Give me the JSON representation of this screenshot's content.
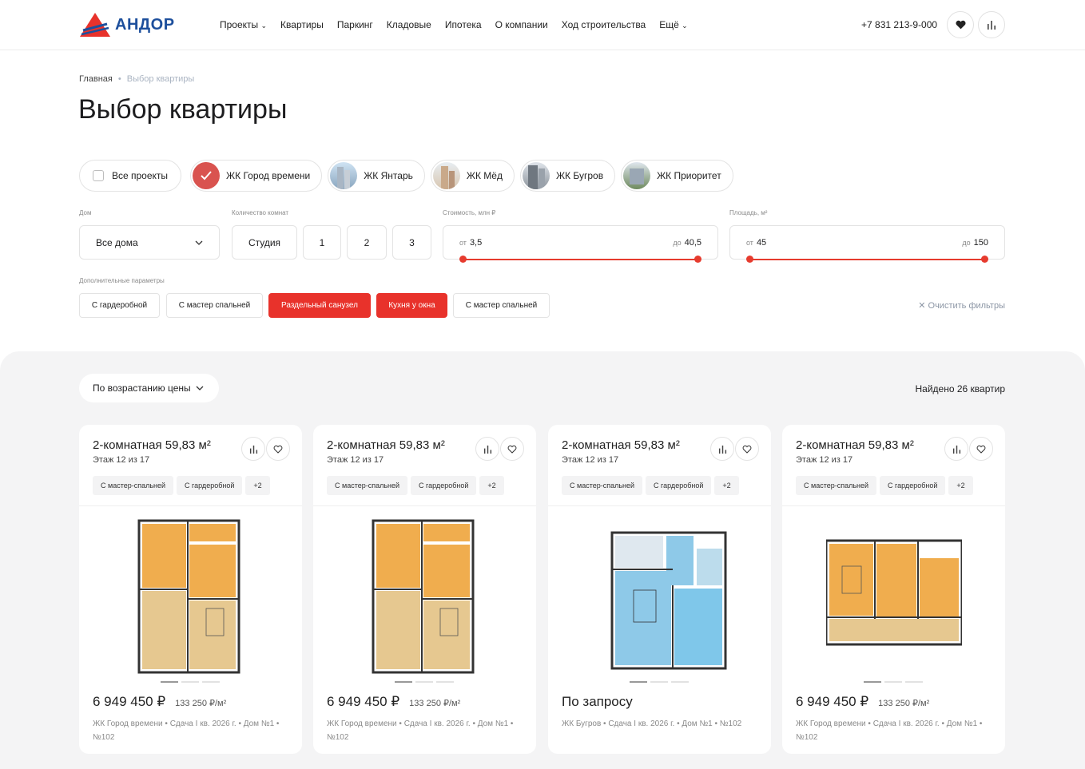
{
  "header": {
    "logo_text": "АНДОР",
    "nav": [
      "Проекты",
      "Квартиры",
      "Паркинг",
      "Кладовые",
      "Ипотека",
      "О компании",
      "Ход строительства",
      "Ещё"
    ],
    "phone": "+7 831 213-9-000"
  },
  "breadcrumb": {
    "home": "Главная",
    "current": "Выбор квартиры"
  },
  "page_title": "Выбор квартиры",
  "projects": {
    "all_label": "Все проекты",
    "items": [
      "ЖК Город времени",
      "ЖК Янтарь",
      "ЖК Мёд",
      "ЖК Бугров",
      "ЖК Приоритет"
    ]
  },
  "filters": {
    "house_label": "Дом",
    "house_value": "Все дома",
    "rooms_label": "Количество комнат",
    "rooms": [
      "Студия",
      "1",
      "2",
      "3"
    ],
    "price_label": "Стоимость, млн ₽",
    "price_from_prefix": "от",
    "price_from": "3,5",
    "price_to_prefix": "до",
    "price_to": "40,5",
    "area_label": "Площадь, м²",
    "area_from_prefix": "от",
    "area_from": "45",
    "area_to_prefix": "до",
    "area_to": "150",
    "extra_label": "Дополнительные параметры",
    "extra": [
      "С гардеробной",
      "С мастер спальней",
      "Раздельный санузел",
      "Кухня у окна",
      "С мастер спальней"
    ],
    "extra_active": [
      false,
      false,
      true,
      true,
      false
    ],
    "clear_label": "✕ Очистить фильтры"
  },
  "listing": {
    "sort_label": "По возрастанию цены",
    "found_label": "Найдено 26 квартир",
    "cards": [
      {
        "title": "2-комнатная 59,83 м²",
        "floor": "Этаж 12 из 17",
        "tags": [
          "С мастер-спальней",
          "С гардеробной",
          "+2"
        ],
        "price": "6 949 450 ₽",
        "price_per_m": "133 250 ₽/м²",
        "meta": "ЖК Город времени • Сдача I кв. 2026 г. • Дом №1 • №102",
        "plan": "orange"
      },
      {
        "title": "2-комнатная 59,83 м²",
        "floor": "Этаж 12 из 17",
        "tags": [
          "С мастер-спальней",
          "С гардеробной",
          "+2"
        ],
        "price": "6 949 450 ₽",
        "price_per_m": "133 250 ₽/м²",
        "meta": "ЖК Город времени • Сдача I кв. 2026 г. • Дом №1 • №102",
        "plan": "orange"
      },
      {
        "title": "2-комнатная 59,83 м²",
        "floor": "Этаж 12 из 17",
        "tags": [
          "С мастер-спальней",
          "С гардеробной",
          "+2"
        ],
        "price": "По запросу",
        "price_per_m": "",
        "meta": "ЖК Бугров • Сдача I кв. 2026 г. • Дом №1 • №102",
        "plan": "blue"
      },
      {
        "title": "2-комнатная 59,83 м²",
        "floor": "Этаж 12 из 17",
        "tags": [
          "С мастер-спальней",
          "С гардеробной",
          "+2"
        ],
        "price": "6 949 450 ₽",
        "price_per_m": "133 250 ₽/м²",
        "meta": "ЖК Город времени • Сдача I кв. 2026 г. • Дом №1 • №102",
        "plan": "orange2"
      }
    ]
  },
  "colors": {
    "accent": "#e8322b",
    "brand": "#1d4f9c",
    "plan_orange": "#f0ad4e",
    "plan_blue": "#8ec9e8"
  }
}
